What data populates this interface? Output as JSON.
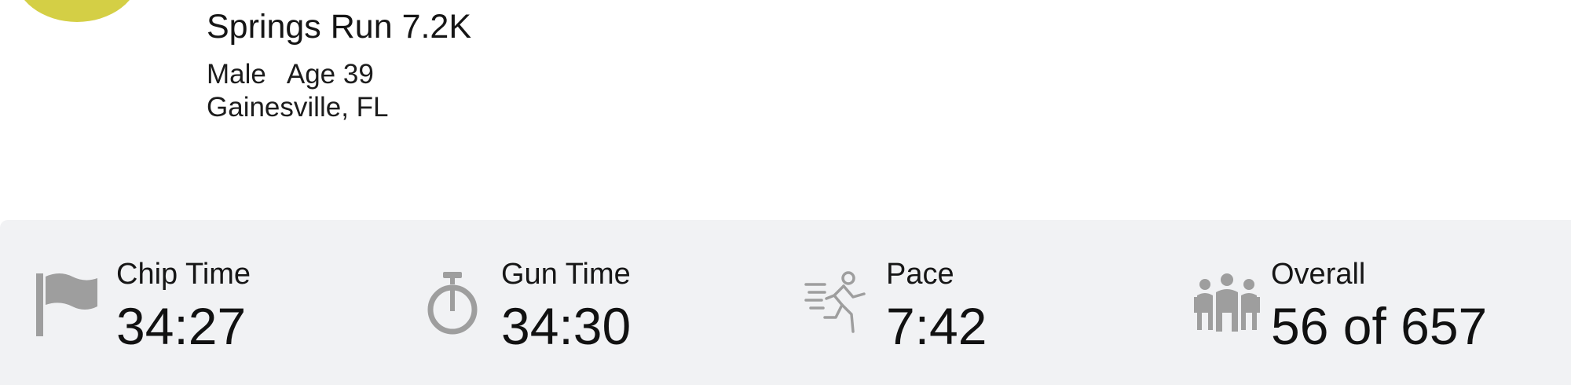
{
  "header": {
    "race_title": "Springs Run 7.2K",
    "gender": "Male",
    "age": "Age 39",
    "location": "Gainesville, FL",
    "avatar_color": "#d4cf45"
  },
  "stats": {
    "chip_time": {
      "label": "Chip Time",
      "value": "34:27",
      "icon": "flag-icon"
    },
    "gun_time": {
      "label": "Gun Time",
      "value": "34:30",
      "icon": "stopwatch-icon"
    },
    "pace": {
      "label": "Pace",
      "value": "7:42",
      "icon": "runner-icon"
    },
    "overall": {
      "label": "Overall",
      "value": "56 of 657",
      "icon": "group-icon"
    }
  },
  "colors": {
    "stats_background": "#f1f2f4",
    "icon_gray": "#9e9e9e"
  }
}
